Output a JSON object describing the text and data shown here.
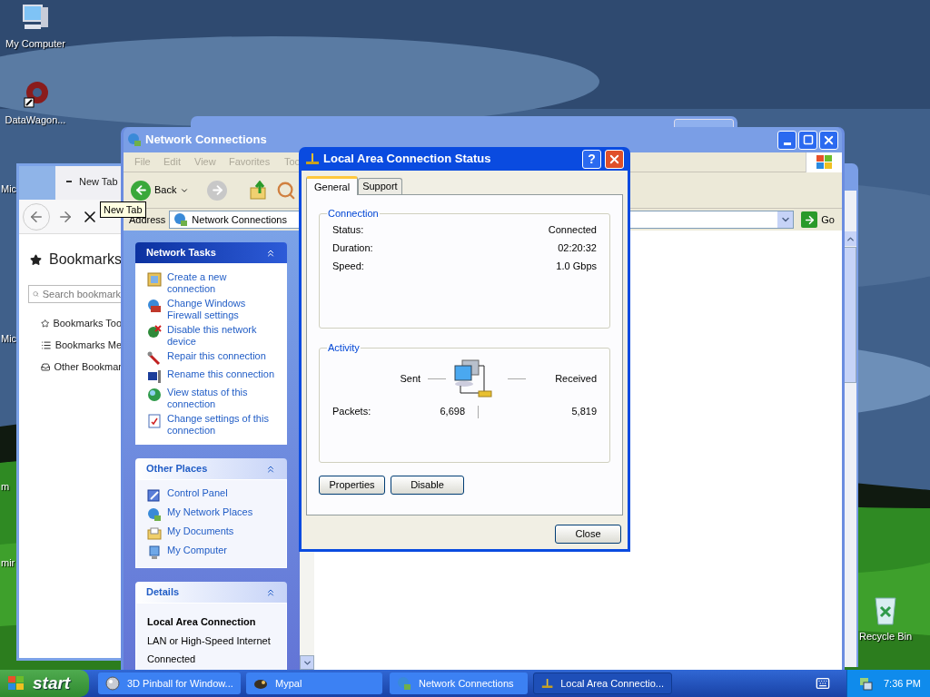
{
  "desktop_icons": [
    {
      "label": "My Computer",
      "kind": "computer"
    },
    {
      "label": "DataWagon...",
      "kind": "shortcut"
    },
    {
      "label": "Mic",
      "kind": "partial"
    },
    {
      "label": "Mic",
      "kind": "partial"
    },
    {
      "label": "m",
      "kind": "partial"
    },
    {
      "label": "mir",
      "kind": "partial"
    },
    {
      "label": "Recycle Bin",
      "kind": "recycle"
    }
  ],
  "browser": {
    "tab_title": "New Tab",
    "tooltip": "New Tab",
    "sidebar_title": "Bookmarks",
    "search_placeholder": "Search bookmark",
    "items": [
      {
        "label": "Bookmarks Too",
        "kind": "toolbar"
      },
      {
        "label": "Bookmarks Me",
        "kind": "menu"
      },
      {
        "label": "Other Bookmar",
        "kind": "other"
      }
    ]
  },
  "explorer": {
    "title": "Network Connections",
    "menu": [
      "File",
      "Edit",
      "View",
      "Favorites",
      "Too"
    ],
    "back_label": "Back",
    "address_label": "Address",
    "address_value": "Network Connections",
    "go_label": "Go",
    "panels": [
      {
        "title": "Network Tasks",
        "kind": "special",
        "items": [
          {
            "label": "Create a new connection",
            "kind": "wizard"
          },
          {
            "label": "Change Windows Firewall settings",
            "kind": "firewall"
          },
          {
            "label": "Disable this network device",
            "kind": "disable"
          },
          {
            "label": "Repair this connection",
            "kind": "repair"
          },
          {
            "label": "Rename this connection",
            "kind": "rename"
          },
          {
            "label": "View status of this connection",
            "kind": "status"
          },
          {
            "label": "Change settings of this connection",
            "kind": "settings"
          }
        ]
      },
      {
        "title": "Other Places",
        "kind": "normal",
        "items": [
          {
            "label": "Control Panel",
            "kind": "control"
          },
          {
            "label": "My Network Places",
            "kind": "network"
          },
          {
            "label": "My Documents",
            "kind": "documents"
          },
          {
            "label": "My Computer",
            "kind": "computer"
          }
        ]
      },
      {
        "title": "Details",
        "kind": "details",
        "heading": "Local Area Connection",
        "lines": [
          "LAN or High-Speed Internet",
          "Connected"
        ]
      }
    ]
  },
  "dialog": {
    "title": "Local Area Connection Status",
    "tabs": [
      {
        "label": "General",
        "selected": true
      },
      {
        "label": "Support",
        "selected": false
      }
    ],
    "connection": {
      "title": "Connection",
      "rows": [
        {
          "label": "Status:",
          "value": "Connected"
        },
        {
          "label": "Duration:",
          "value": "02:20:32"
        },
        {
          "label": "Speed:",
          "value": "1.0 Gbps"
        }
      ]
    },
    "activity": {
      "title": "Activity",
      "sent_label": "Sent",
      "received_label": "Received",
      "packets_label": "Packets:",
      "sent": "6,698",
      "received": "5,819"
    },
    "buttons": [
      "Properties",
      "Disable"
    ],
    "close": "Close",
    "help_glyph": "?"
  },
  "taskbar": {
    "start": "start",
    "tasks": [
      {
        "label": "3D Pinball for Window...",
        "kind": "pinball",
        "selected": false
      },
      {
        "label": "Mypal",
        "kind": "mypal",
        "selected": false
      },
      {
        "label": "Network Connections",
        "kind": "network",
        "selected": false
      },
      {
        "label": "Local Area Connectio...",
        "kind": "lan",
        "selected": true
      }
    ],
    "clock": "7:36 PM"
  }
}
